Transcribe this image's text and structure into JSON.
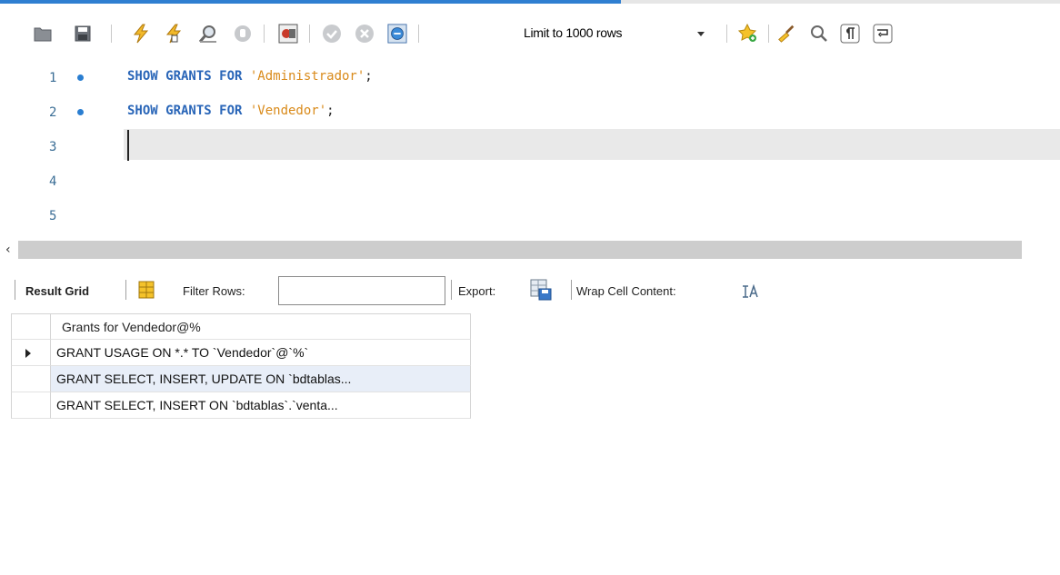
{
  "toolbar": {
    "limit_rows": "Limit to 1000 rows",
    "buttons": [
      {
        "name": "open-folder-icon"
      },
      {
        "name": "save-icon"
      },
      {
        "name": "execute-lightning-icon"
      },
      {
        "name": "execute-current-icon"
      },
      {
        "name": "explain-magnifier-icon"
      },
      {
        "name": "stop-icon"
      },
      {
        "name": "toggle-error-icon"
      },
      {
        "name": "commit-icon"
      },
      {
        "name": "rollback-icon"
      },
      {
        "name": "autocommit-icon"
      },
      {
        "name": "bookmark-star-icon"
      },
      {
        "name": "beautify-brush-icon"
      },
      {
        "name": "find-icon"
      },
      {
        "name": "invisible-chars-icon"
      },
      {
        "name": "wrap-lines-icon"
      }
    ]
  },
  "editor": {
    "lines": [
      {
        "num": "1",
        "kw": "SHOW GRANTS FOR ",
        "str": "'Administrador'",
        "end": ";"
      },
      {
        "num": "2",
        "kw": "SHOW GRANTS FOR ",
        "str": "'Vendedor'",
        "end": ";"
      },
      {
        "num": "3",
        "kw": "",
        "str": "",
        "end": ""
      },
      {
        "num": "4",
        "kw": "",
        "str": "",
        "end": ""
      },
      {
        "num": "5",
        "kw": "",
        "str": "",
        "end": ""
      }
    ]
  },
  "result_toolbar": {
    "result_grid": "Result Grid",
    "filter_rows": "Filter Rows:",
    "filter_value": "",
    "export": "Export:",
    "wrap_cell": "Wrap Cell Content:"
  },
  "grid": {
    "column": "Grants for Vendedor@%",
    "rows": [
      "GRANT USAGE ON *.* TO `Vendedor`@`%`",
      "GRANT SELECT, INSERT, UPDATE ON `bdtablas...",
      "GRANT SELECT, INSERT ON `bdtablas`.`venta..."
    ]
  },
  "colors": {
    "accent": "#2f7fd1",
    "keyword": "#2a66b8",
    "string": "#d98a1a"
  }
}
